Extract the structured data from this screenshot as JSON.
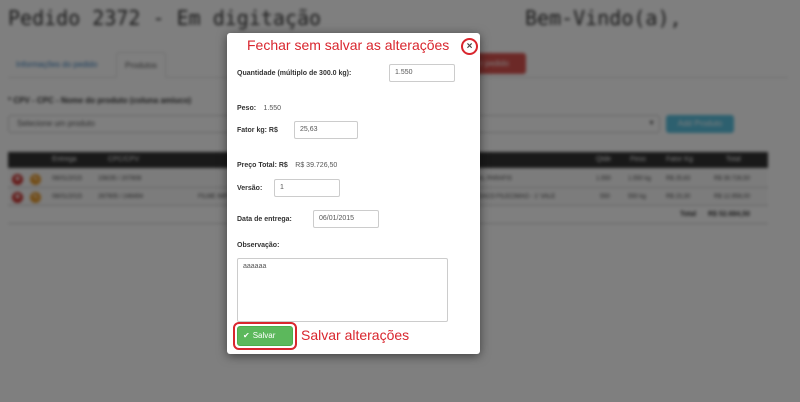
{
  "page": {
    "title": "Pedido 2372 - Em digitação",
    "welcome": "Bem-Vindo(a),",
    "tabs": [
      "Informações do pedido",
      "Produtos"
    ],
    "red_button_label": "r pedido",
    "product_label": "* CPV - CPC - Nome do produto (coluna amiuco)",
    "product_select_placeholder": "Selecione um produto",
    "add_button_label": "Add Produto"
  },
  "grid": {
    "headers": [
      "Entrega",
      "CPC/CPV",
      "Qtde",
      "Peso",
      "Fator Kg",
      "Total"
    ],
    "rows": [
      {
        "entrega": "06/01/2015",
        "cpc": "156/35 / 207808",
        "produto": "AL PARAFIS",
        "qtde": "1.550",
        "peso": "1.550 kg",
        "fator": "R$ 25,63",
        "total": "R$ 39.726,50"
      },
      {
        "entrega": "06/01/2015",
        "cpc": "267905 / 246494",
        "produto": "FILME IMP CRI",
        "produto2": "SACO FILECIMAO - 1' VALE",
        "qtde": "550",
        "peso": "550 kg",
        "fator": "R$ 23,30",
        "total": "R$ 12.958,00"
      }
    ],
    "total_label": "Total",
    "total_value": "R$ 52.684,50"
  },
  "modal": {
    "close_annotation": "Fechar sem salvar as alterações",
    "quantidade_label": "Quantidade (múltiplo de 300.0 kg):",
    "quantidade_value": "1.550",
    "peso_label": "Peso:",
    "peso_value": "1.550",
    "fator_label": "Fator kg: R$",
    "fator_value": "25,63",
    "preco_total_label": "Preço Total: R$",
    "preco_total_value": "R$ 39.726,50",
    "versao_label": "Versão:",
    "versao_value": "1",
    "data_entrega_label": "Data de entrega:",
    "data_entrega_value": "06/01/2015",
    "observacao_label": "Observação:",
    "observacao_value": "aaaaaa",
    "save_button_label": "Salvar",
    "save_annotation": "Salvar alterações"
  },
  "colors": {
    "annotation_red": "#d9262e",
    "save_green": "#5cb85c",
    "grid_header": "#333333",
    "overlay": "rgba(0,0,0,0.5)"
  }
}
